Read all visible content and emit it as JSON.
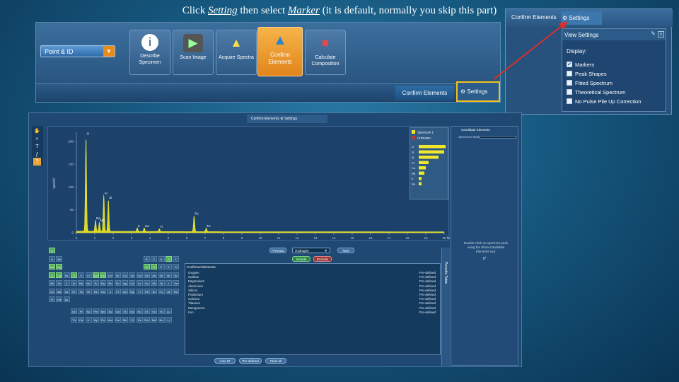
{
  "title": {
    "pre": "Click ",
    "setting": "Setting",
    "mid": " then select ",
    "marker": "Marker",
    "post": " (it is default, normally you skip this part)"
  },
  "toolbar": {
    "point_id": "Point & ID",
    "steps": [
      {
        "label": "Describe Specimen",
        "icon": "info-icon"
      },
      {
        "label": "Scan Image",
        "icon": "camera-icon"
      },
      {
        "label": "Acquire Spectra",
        "icon": "spectrum-icon"
      },
      {
        "label": "Confirm Elements",
        "icon": "check-pyramid-icon",
        "active": true
      },
      {
        "label": "Calculate Composition",
        "icon": "cubes-icon"
      }
    ],
    "confirm_elements": "Confirm Elements",
    "settings": "Settings"
  },
  "callout": {
    "confirm_elements": "Confirm Elements",
    "settings": "Settings",
    "panel_title": "View Settings",
    "display_label": "Display:",
    "options": [
      {
        "label": "Markers",
        "checked": true
      },
      {
        "label": "Peak Shapes",
        "checked": false
      },
      {
        "label": "Fitted Spectrum",
        "checked": false
      },
      {
        "label": "Theoretical Spectrum",
        "checked": false
      },
      {
        "label": "No Pulse Pile Up Correction",
        "checked": false
      }
    ]
  },
  "main": {
    "tab_confirm": "Confirm Elements",
    "tab_settings": "Settings",
    "candidate_title": "Candidate Elements",
    "spectrum_match": "Spectrum Match",
    "note": "Double Click on spectrum peak using the Show Candidate Elements tool.",
    "count": "0\"",
    "controls": {
      "previous": "Previous",
      "element": "Hydrogen",
      "next": "Next",
      "include": "Include",
      "exclude": "Exclude"
    },
    "confirmed_header": "Confirmed Elements",
    "confirmed": [
      [
        "Oxygen",
        "Pre-defined"
      ],
      [
        "Sodium",
        "Pre-defined"
      ],
      [
        "Magnesium",
        "Pre-defined"
      ],
      [
        "Aluminium",
        "Pre-defined"
      ],
      [
        "Silicon",
        "Pre-defined"
      ],
      [
        "Potassium",
        "Pre-defined"
      ],
      [
        "Calcium",
        "Pre-defined"
      ],
      [
        "Titanium",
        "Pre-defined"
      ],
      [
        "Manganese",
        "Pre-defined"
      ],
      [
        "Iron",
        "Pre-defined"
      ]
    ],
    "bottom": {
      "auto_id": "Auto ID",
      "pre_defined": "Pre-defined",
      "clear_all": "Clear all"
    },
    "periodic_side": "Periodic Table"
  },
  "chart_data": {
    "type": "line",
    "xlabel": "keV",
    "ylabel": "cps/eV",
    "x_ticks": [
      0,
      1,
      2,
      3,
      4,
      5,
      6,
      7,
      8,
      9,
      10,
      11,
      12,
      13,
      14,
      15,
      16,
      17,
      18,
      19,
      20
    ],
    "y_ticks": [
      0,
      50,
      100,
      150,
      200
    ],
    "peaks": [
      {
        "label": "O",
        "x": 0.52,
        "y": 210
      },
      {
        "label": "Na",
        "x": 1.04,
        "y": 25
      },
      {
        "label": "Mg",
        "x": 1.25,
        "y": 20
      },
      {
        "label": "Al",
        "x": 1.49,
        "y": 80
      },
      {
        "label": "Si",
        "x": 1.74,
        "y": 70
      },
      {
        "label": "K",
        "x": 3.31,
        "y": 8
      },
      {
        "label": "Ca",
        "x": 3.69,
        "y": 8
      },
      {
        "label": "Ti",
        "x": 4.51,
        "y": 6
      },
      {
        "label": "Fe",
        "x": 6.4,
        "y": 35
      },
      {
        "label": "Fe",
        "x": 7.06,
        "y": 8
      }
    ],
    "legend": [
      "Spectrum 1",
      "Unknown"
    ],
    "match_labels": [
      "O",
      "Si",
      "Al",
      "Fe",
      "Ca",
      "Mg",
      "K",
      "Na"
    ],
    "match_values": [
      0.95,
      0.9,
      0.7,
      0.35,
      0.25,
      0.2,
      0.1,
      0.1
    ]
  }
}
